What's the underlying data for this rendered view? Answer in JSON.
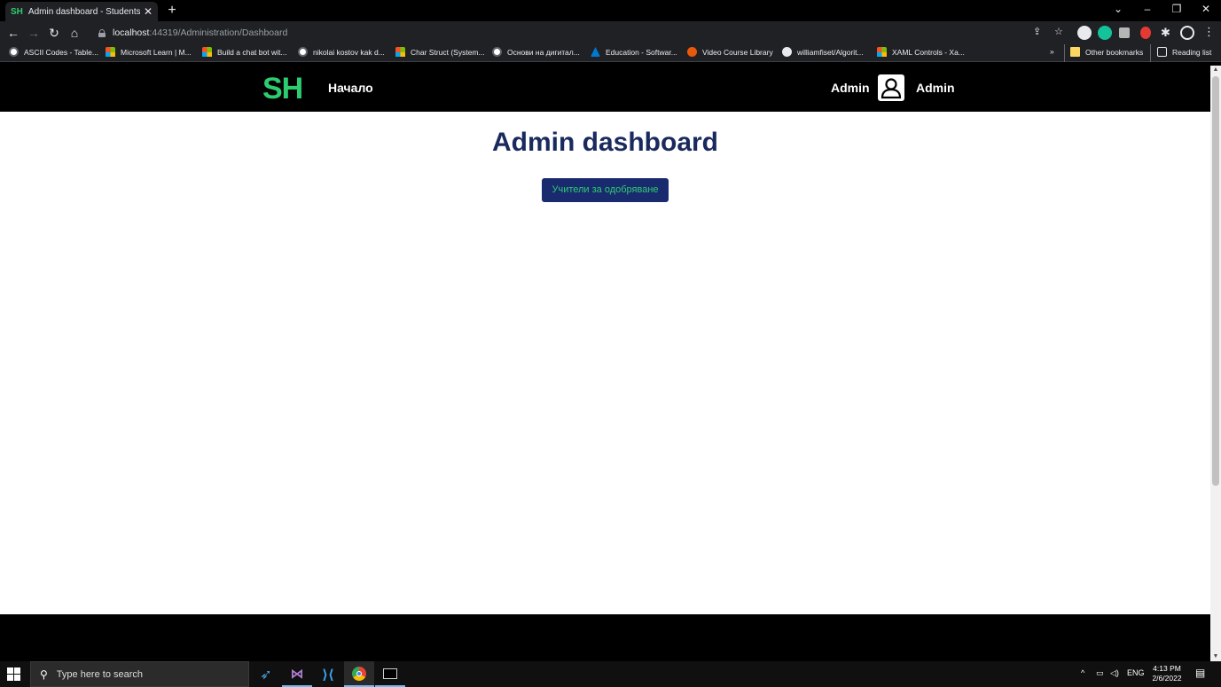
{
  "browser": {
    "tab_title": "Admin dashboard - StudentsHelp",
    "tab_favicon": "SH",
    "url_host": "localhost",
    "url_path": ":44319/Administration/Dashboard"
  },
  "bookmarks": [
    {
      "label": "ASCII Codes - Table...",
      "icon": "site-icon"
    },
    {
      "label": "Microsoft Learn | M...",
      "icon": "microsoft-icon"
    },
    {
      "label": "Build a chat bot wit...",
      "icon": "microsoft-icon"
    },
    {
      "label": "nikolai kostov kak d...",
      "icon": "google-icon"
    },
    {
      "label": "Char Struct (System...",
      "icon": "microsoft-icon"
    },
    {
      "label": "Основи на дигитал...",
      "icon": "google-icon"
    },
    {
      "label": "Education - Softwar...",
      "icon": "azure-icon"
    },
    {
      "label": "Video Course Library",
      "icon": "play-icon"
    },
    {
      "label": "williamfiset/Algorit...",
      "icon": "github-icon"
    },
    {
      "label": "XAML Controls - Xa...",
      "icon": "microsoft-icon"
    }
  ],
  "bookmarks_right": {
    "overflow": "»",
    "other": "Other bookmarks",
    "reading_list": "Reading list"
  },
  "site_nav": {
    "logo": "SH",
    "home": "Начало",
    "user_name": "Admin",
    "role": "Admin"
  },
  "main": {
    "title": "Admin dashboard",
    "approve_button": "Учители за одобряване"
  },
  "taskbar": {
    "search_placeholder": "Type here to search",
    "language": "ENG",
    "time": "4:13 PM",
    "date": "2/6/2022"
  },
  "colors": {
    "logo_green": "#2ecc71",
    "title_navy": "#1a2a5e",
    "button_navy": "#1a2a6e"
  }
}
